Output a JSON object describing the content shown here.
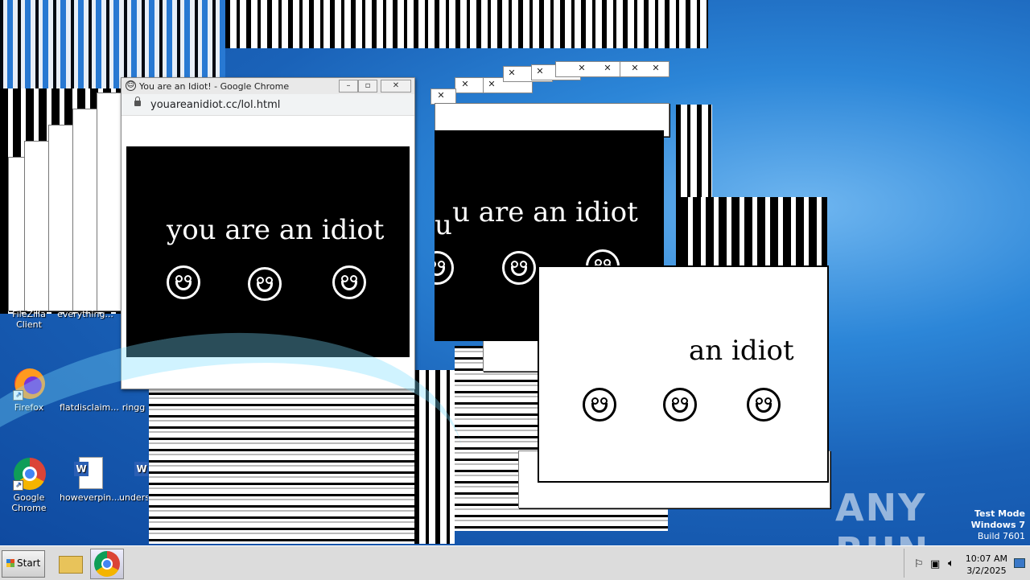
{
  "desktop": {
    "icons": [
      {
        "name": "FileZilla Client"
      },
      {
        "name": "everything..."
      },
      {
        "name": "Firefox"
      },
      {
        "name": "flatdisclaim..."
      },
      {
        "name": "ringg"
      },
      {
        "name": "Google Chrome"
      },
      {
        "name": "howeverpin..."
      },
      {
        "name": "unders"
      }
    ]
  },
  "chrome_window": {
    "title": "You are an Idiot! - Google Chrome",
    "url": "youareanidiot.cc/lol.html",
    "page_text": "you are an idiot"
  },
  "popup_center": {
    "text": "u are an idiot",
    "partial_text": "u"
  },
  "popup_white": {
    "text": "an idiot"
  },
  "taskbar": {
    "start_label": "Start",
    "time": "10:07 AM",
    "date": "3/2/2025"
  },
  "watermark": "ANY RUN",
  "system": {
    "line1": "Test Mode",
    "line2": "Windows 7",
    "line3": "Build 7601"
  },
  "colors": {
    "desktop_blue": "#1a62b8",
    "taskbar": "#dcdcdc",
    "panel_black": "#000000"
  }
}
